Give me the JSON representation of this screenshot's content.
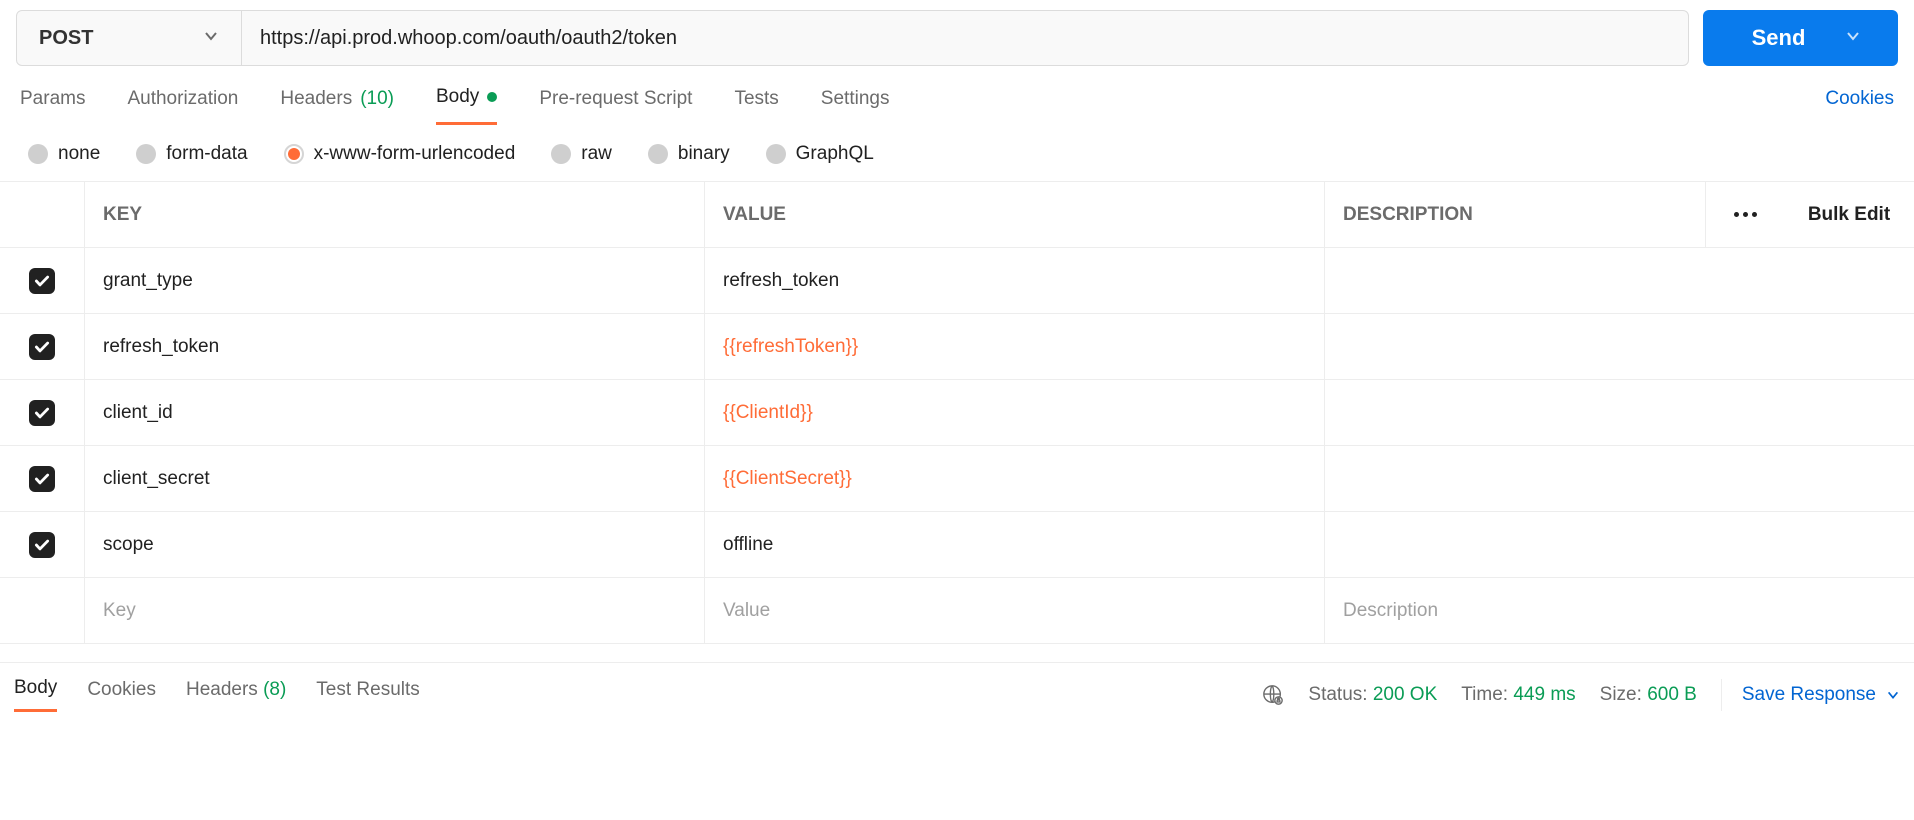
{
  "request": {
    "method": "POST",
    "url": "https://api.prod.whoop.com/oauth/oauth2/token",
    "send_label": "Send"
  },
  "tabs": {
    "items": [
      {
        "label": "Params",
        "count": null,
        "active": false
      },
      {
        "label": "Authorization",
        "count": null,
        "active": false
      },
      {
        "label": "Headers",
        "count": "(10)",
        "active": false
      },
      {
        "label": "Body",
        "count": null,
        "active": true,
        "indicator": true
      },
      {
        "label": "Pre-request Script",
        "count": null,
        "active": false
      },
      {
        "label": "Tests",
        "count": null,
        "active": false
      },
      {
        "label": "Settings",
        "count": null,
        "active": false
      }
    ],
    "cookies_label": "Cookies"
  },
  "body_types": {
    "options": [
      {
        "label": "none",
        "selected": false
      },
      {
        "label": "form-data",
        "selected": false
      },
      {
        "label": "x-www-form-urlencoded",
        "selected": true
      },
      {
        "label": "raw",
        "selected": false
      },
      {
        "label": "binary",
        "selected": false
      },
      {
        "label": "GraphQL",
        "selected": false
      }
    ]
  },
  "params_table": {
    "headers": {
      "key": "KEY",
      "value": "VALUE",
      "description": "DESCRIPTION"
    },
    "bulk_edit": "Bulk Edit",
    "rows": [
      {
        "checked": true,
        "key": "grant_type",
        "value": "refresh_token",
        "is_var": false
      },
      {
        "checked": true,
        "key": "refresh_token",
        "value": "{{refreshToken}}",
        "is_var": true
      },
      {
        "checked": true,
        "key": "client_id",
        "value": "{{ClientId}}",
        "is_var": true
      },
      {
        "checked": true,
        "key": "client_secret",
        "value": "{{ClientSecret}}",
        "is_var": true
      },
      {
        "checked": true,
        "key": "scope",
        "value": "offline",
        "is_var": false
      }
    ],
    "placeholder": {
      "key": "Key",
      "value": "Value",
      "description": "Description"
    }
  },
  "response": {
    "tabs": [
      {
        "label": "Body",
        "count": null,
        "active": true
      },
      {
        "label": "Cookies",
        "count": null,
        "active": false
      },
      {
        "label": "Headers",
        "count": "(8)",
        "active": false
      },
      {
        "label": "Test Results",
        "count": null,
        "active": false
      }
    ],
    "status_label": "Status:",
    "status_value": "200 OK",
    "time_label": "Time:",
    "time_value": "449 ms",
    "size_label": "Size:",
    "size_value": "600 B",
    "save_label": "Save Response"
  }
}
